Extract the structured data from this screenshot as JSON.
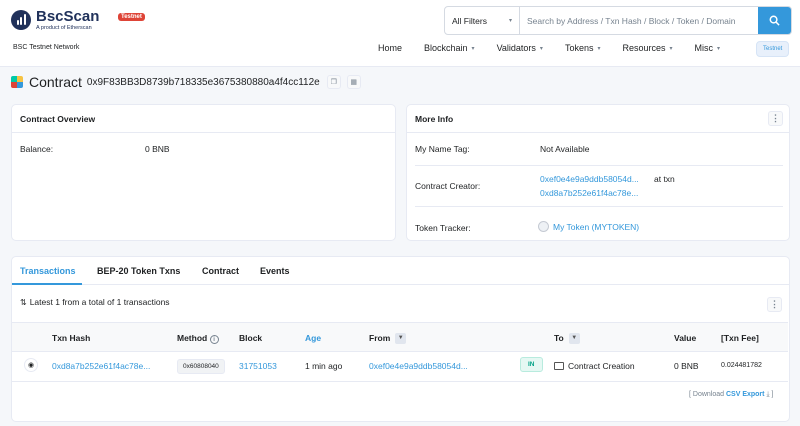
{
  "header": {
    "brand": "BscScan",
    "brand_sub": "A product of Etherscan",
    "badge": "Testnet",
    "network": "BSC Testnet Network",
    "search": {
      "filter": "All Filters",
      "placeholder": "Search by Address / Txn Hash / Block / Token / Domain"
    },
    "nav": [
      "Home",
      "Blockchain",
      "Validators",
      "Tokens",
      "Resources",
      "Misc"
    ],
    "nav_badge": "Testnet"
  },
  "page": {
    "title": "Contract",
    "address": "0x9F83BB3D8739b718335e3675380880a4f4cc112e"
  },
  "overview": {
    "heading": "Contract Overview",
    "balance_label": "Balance:",
    "balance_value": "0 BNB"
  },
  "more_info": {
    "heading": "More Info",
    "name_tag_label": "My Name Tag:",
    "name_tag_value": "Not Available",
    "creator_label": "Contract Creator:",
    "creator_address": "0xef0e4e9a9ddb58054d...",
    "creator_at": "at txn",
    "creator_txn": "0xd8a7b252e61f4ac78e...",
    "tracker_label": "Token Tracker:",
    "tracker_value": "My Token (MYTOKEN)"
  },
  "tabs": [
    "Transactions",
    "BEP-20 Token Txns",
    "Contract",
    "Events"
  ],
  "txn_summary": "Latest 1 from a total of 1 transactions",
  "table": {
    "headers": [
      "Txn Hash",
      "Method",
      "Block",
      "Age",
      "From",
      "To",
      "Value",
      "[Txn Fee]"
    ],
    "rows": [
      {
        "hash": "0xd8a7b252e61f4ac78e...",
        "method": "0x60808040",
        "block": "31751053",
        "age": "1 min ago",
        "from": "0xef0e4e9a9ddb58054d...",
        "direction": "IN",
        "to": "Contract Creation",
        "value": "0 BNB",
        "fee": "0.024481782"
      }
    ]
  },
  "footer": {
    "prefix": "[ Download",
    "link": "CSV Export",
    "suffix": "]"
  },
  "colors": {
    "accent": "#3498db",
    "brand": "#21325b",
    "badge_red": "#de4437",
    "success": "#00c9a7"
  }
}
